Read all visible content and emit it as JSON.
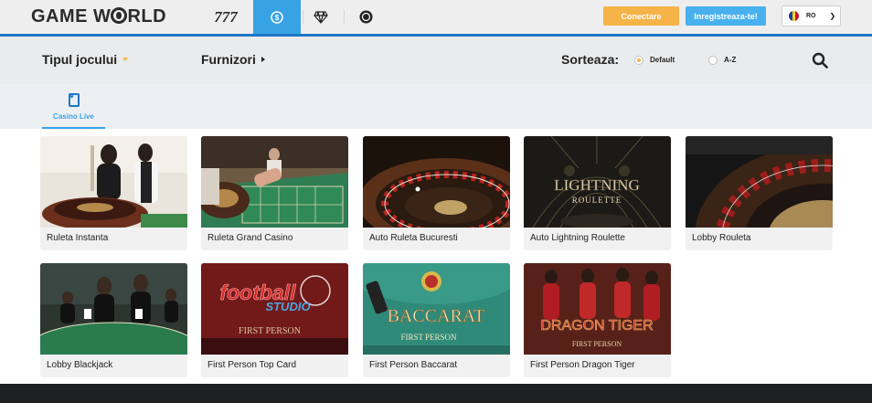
{
  "header": {
    "logo_left": "GAME W",
    "logo_right": "RLD",
    "nav_777": "777",
    "login_label": "Conectare",
    "register_label": "Inregistreaza-te!",
    "language": "RO",
    "accent": "#1d76c8",
    "active_nav": "#37a3e5"
  },
  "filters": {
    "game_type": "Tipul jocului",
    "providers": "Furnizori",
    "sort_label": "Sorteaza:",
    "sort_options": [
      "Default",
      "A-Z"
    ],
    "sort_selected": "Default"
  },
  "category": {
    "label": "Casino Live"
  },
  "games": [
    {
      "name": "Ruleta Instanta",
      "icon": "roulette-dealers-thumbnail"
    },
    {
      "name": "Ruleta Grand Casino",
      "icon": "roulette-table-thumbnail"
    },
    {
      "name": "Auto Ruleta Bucuresti",
      "icon": "roulette-wheel-thumbnail"
    },
    {
      "name": "Auto Lightning Roulette",
      "icon": "lightning-roulette-thumbnail",
      "thumb_text": [
        "LIGHTNING",
        "ROULETTE"
      ]
    },
    {
      "name": "Lobby Rouleta",
      "icon": "roulette-wheel-closeup-thumbnail"
    },
    {
      "name": "Lobby Blackjack",
      "icon": "blackjack-dealers-thumbnail"
    },
    {
      "name": "First Person Top Card",
      "icon": "football-studio-thumbnail",
      "thumb_text": [
        "football",
        "STUDIO",
        "FIRST PERSON"
      ]
    },
    {
      "name": "First Person Baccarat",
      "icon": "baccarat-thumbnail",
      "thumb_text": [
        "BACCARAT",
        "FIRST PERSON"
      ]
    },
    {
      "name": "First Person Dragon Tiger",
      "icon": "dragon-tiger-thumbnail",
      "thumb_text": [
        "DRAGON TIGER",
        "FIRST PERSON"
      ]
    }
  ]
}
